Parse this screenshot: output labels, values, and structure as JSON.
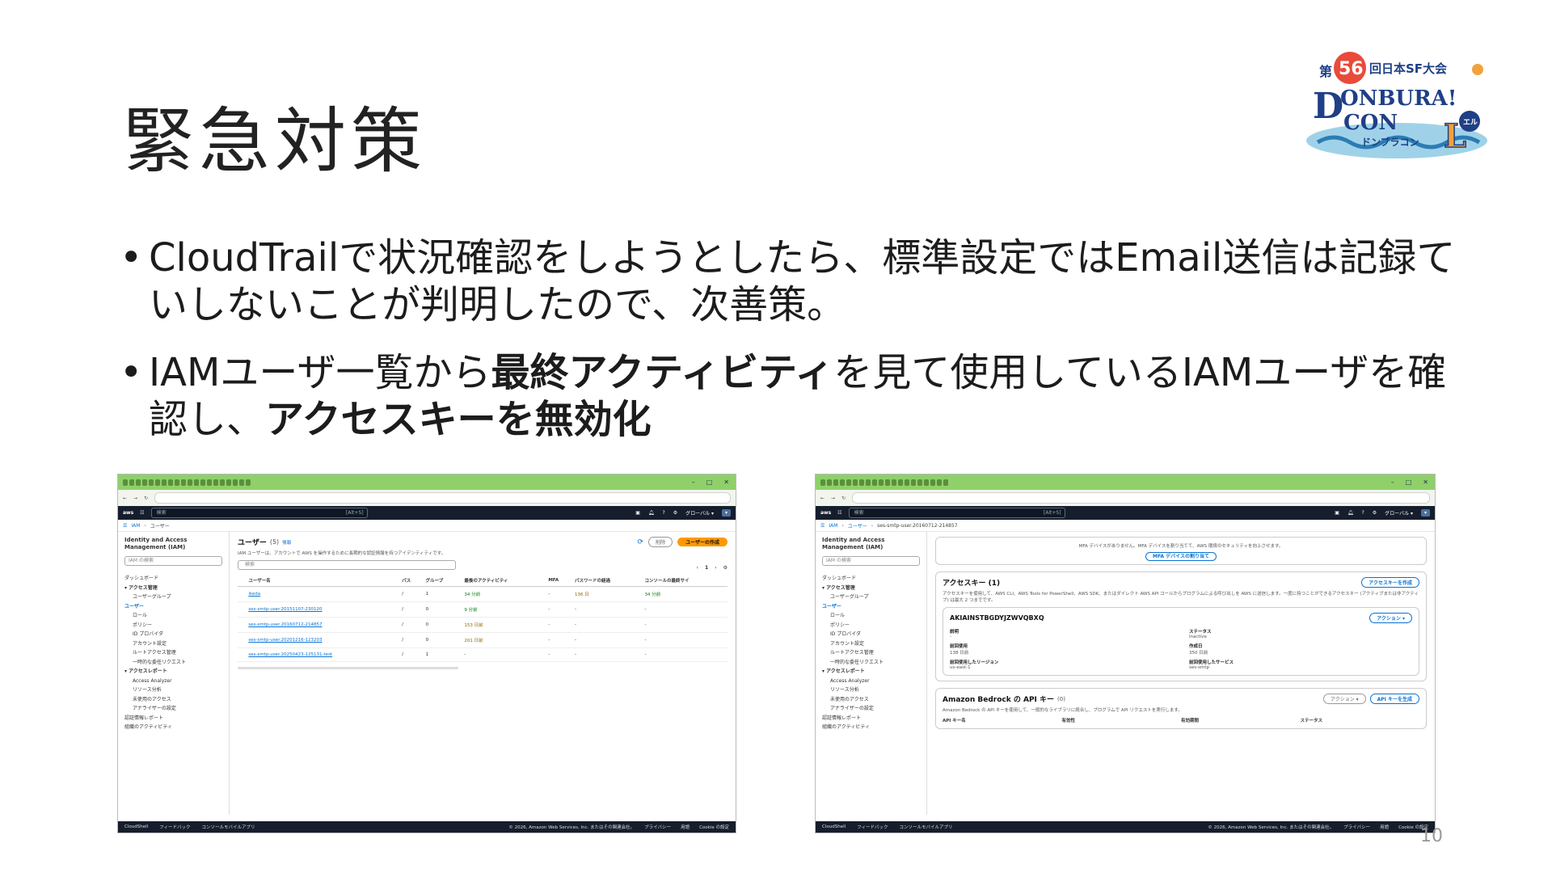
{
  "slide": {
    "title": "緊急対策",
    "page_number": "10",
    "logo": {
      "lines": [
        "第",
        "56",
        "回日本SF大会",
        "DONBURA",
        "CON",
        "L",
        "ドンブラコン",
        "エルエル"
      ]
    },
    "bullets": [
      {
        "dot": "•",
        "text": "CloudTrailで状況確認をしようとしたら、標準設定ではEmail送信は記録ていしないことが判明したので、次善策。"
      },
      {
        "dot": "•",
        "pre": "IAMユーザ一覧から",
        "bold1": "最終アクティビティ",
        "mid": "を見て使用しているIAMユーザを確認し、",
        "bold2": "アクセスキーを無効化"
      }
    ]
  },
  "left_screenshot": {
    "aws_search": "検索",
    "aws_shortcut": "[Alt+S]",
    "region": "グローバル ▾",
    "breadcrumb": [
      "IAM",
      "ユーザー"
    ],
    "sidebar": {
      "service": "Identity and Access Management (IAM)",
      "search_placeholder": "IAM の検索",
      "items": [
        {
          "label": "ダッシュボード",
          "type": "it"
        },
        {
          "label": "▾ アクセス管理",
          "type": "hd"
        },
        {
          "label": "ユーザーグループ",
          "type": "sub"
        },
        {
          "label": "ユーザー",
          "type": "act"
        },
        {
          "label": "ロール",
          "type": "sub"
        },
        {
          "label": "ポリシー",
          "type": "sub"
        },
        {
          "label": "ID プロバイダ",
          "type": "sub"
        },
        {
          "label": "アカウント設定",
          "type": "sub"
        },
        {
          "label": "ルートアクセス管理",
          "type": "sub"
        },
        {
          "label": "一時的な委任リクエスト",
          "type": "sub"
        },
        {
          "label": "▾ アクセスレポート",
          "type": "hd"
        },
        {
          "label": "Access Analyzer",
          "type": "sub"
        },
        {
          "label": "リソース分析",
          "type": "sub"
        },
        {
          "label": "未使用のアクセス",
          "type": "sub"
        },
        {
          "label": "アナライザーの設定",
          "type": "sub"
        },
        {
          "label": "認証情報レポート",
          "type": "it"
        },
        {
          "label": "組織のアクティビティ",
          "type": "it"
        }
      ]
    },
    "main": {
      "heading": "ユーザー",
      "count": "(5)",
      "info": "情報",
      "description": "IAM ユーザーは、アカウントで AWS を操作するために長期的な認証情報を持つアイデンティティです。",
      "search_placeholder": "検索",
      "delete_button": "削除",
      "create_button": "ユーザーの作成",
      "page": "1",
      "columns": [
        "ユーザー名",
        "パス",
        "グループ",
        "最後のアクティビティ",
        "MFA",
        "パスワードの経過",
        "コンソールの最終サイ"
      ],
      "rows": [
        [
          "ikeda",
          "/",
          "1",
          "34 分前",
          "-",
          "136 日",
          "34 分前"
        ],
        [
          "ses-smtp-user.20151107-230120",
          "/",
          "0",
          "9 分前",
          "-",
          "-",
          "-"
        ],
        [
          "ses-smtp-user.20160712-214857",
          "/",
          "0",
          "153 日前",
          "-",
          "-",
          "-"
        ],
        [
          "ses-smtp-user.20201216-123203",
          "/",
          "0",
          "201 日前",
          "-",
          "-",
          "-"
        ],
        [
          "ses-smtp-user.20250423-125131-test",
          "/",
          "1",
          "-",
          "-",
          "-",
          "-"
        ]
      ]
    },
    "footer": {
      "items": [
        "CloudShell",
        "フィードバック",
        "コンソールモバイルアプリ"
      ],
      "copyright": "© 2026, Amazon Web Services, Inc. またはその関連会社。",
      "links": [
        "プライバシー",
        "用語",
        "Cookie の設定"
      ]
    }
  },
  "right_screenshot": {
    "aws_search": "検索",
    "aws_shortcut": "[Alt+S]",
    "region": "グローバル ▾",
    "breadcrumb": [
      "IAM",
      "ユーザー",
      "ses-smtp-user.20160712-214857"
    ],
    "mfa": {
      "note": "MFA デバイスがありません。MFA デバイスを割り当てて、AWS 環境のセキュリティを向上させます。",
      "button": "MFA デバイスの割り当て"
    },
    "access_keys": {
      "heading": "アクセスキー (1)",
      "create_button": "アクセスキーを作成",
      "description": "アクセスキーを使用して、AWS CLI、AWS Tools for PowerShell、AWS SDK、またはダイレクト AWS API コールからプログラムによる呼び出しを AWS に送信します。一度に持つことができるアクセスキー (アクティブまたは非アクティブ) は最大 2 つまでです。",
      "key_id": "AKIAINSTBGDYJZWVQBXQ",
      "action_button": "アクション ▾",
      "fields": [
        {
          "k": "説明",
          "v": "-"
        },
        {
          "k": "ステータス",
          "v": "Inactive"
        },
        {
          "k": "前回使用",
          "v": "138 日前"
        },
        {
          "k": "作成日",
          "v": "350 日前"
        },
        {
          "k": "前回使用したリージョン",
          "v": "us-east-1"
        },
        {
          "k": "前回使用したサービス",
          "v": "ses-smtp"
        }
      ]
    },
    "bedrock": {
      "heading": "Amazon Bedrock の API キー",
      "count": "(0)",
      "action_button": "アクション ▾",
      "generate_button": "API キーを生成",
      "description": "Amazon Bedrock の API キーを使用して、一般的なライブラリに統合し、プログラムで API リクエストを実行します。",
      "columns": [
        "API キー名",
        "有効性",
        "有効期間",
        "ステータス"
      ]
    },
    "footer": {
      "items": [
        "CloudShell",
        "フィードバック",
        "コンソールモバイルアプリ"
      ],
      "copyright": "© 2026, Amazon Web Services, Inc. またはその関連会社。",
      "links": [
        "プライバシー",
        "用語",
        "Cookie の設定"
      ]
    }
  }
}
